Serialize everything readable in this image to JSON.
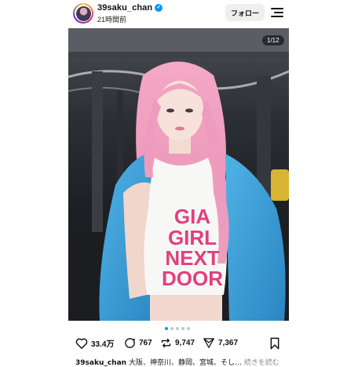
{
  "post": {
    "username": "39saku_chan",
    "timestamp": "21時間前",
    "follow_label": "フォロー",
    "media_counter": "1/12",
    "carousel": {
      "total_dots": 5,
      "active_index": 0
    }
  },
  "photo_text": {
    "shirt_lines": [
      "GIA",
      "GIRL",
      "NEXT",
      "DOOR"
    ]
  },
  "actions": {
    "likes": "33.4万",
    "comments": "767",
    "reposts": "9,747",
    "shares": "7,367"
  },
  "caption": {
    "username": "39saku_chan",
    "text": "大阪、神奈川、静岡、宮城、そし…",
    "more_label": "続きを読む"
  },
  "colors": {
    "verified": "#0095f6",
    "follow_bg": "#efefef",
    "hair": "#f2a7c3",
    "jacket": "#3c9fd6",
    "shirt_text": "#e0407f"
  },
  "icons": [
    "verified-badge-icon",
    "menu-icon",
    "heart-icon",
    "comment-icon",
    "repost-icon",
    "share-icon",
    "bookmark-icon"
  ]
}
